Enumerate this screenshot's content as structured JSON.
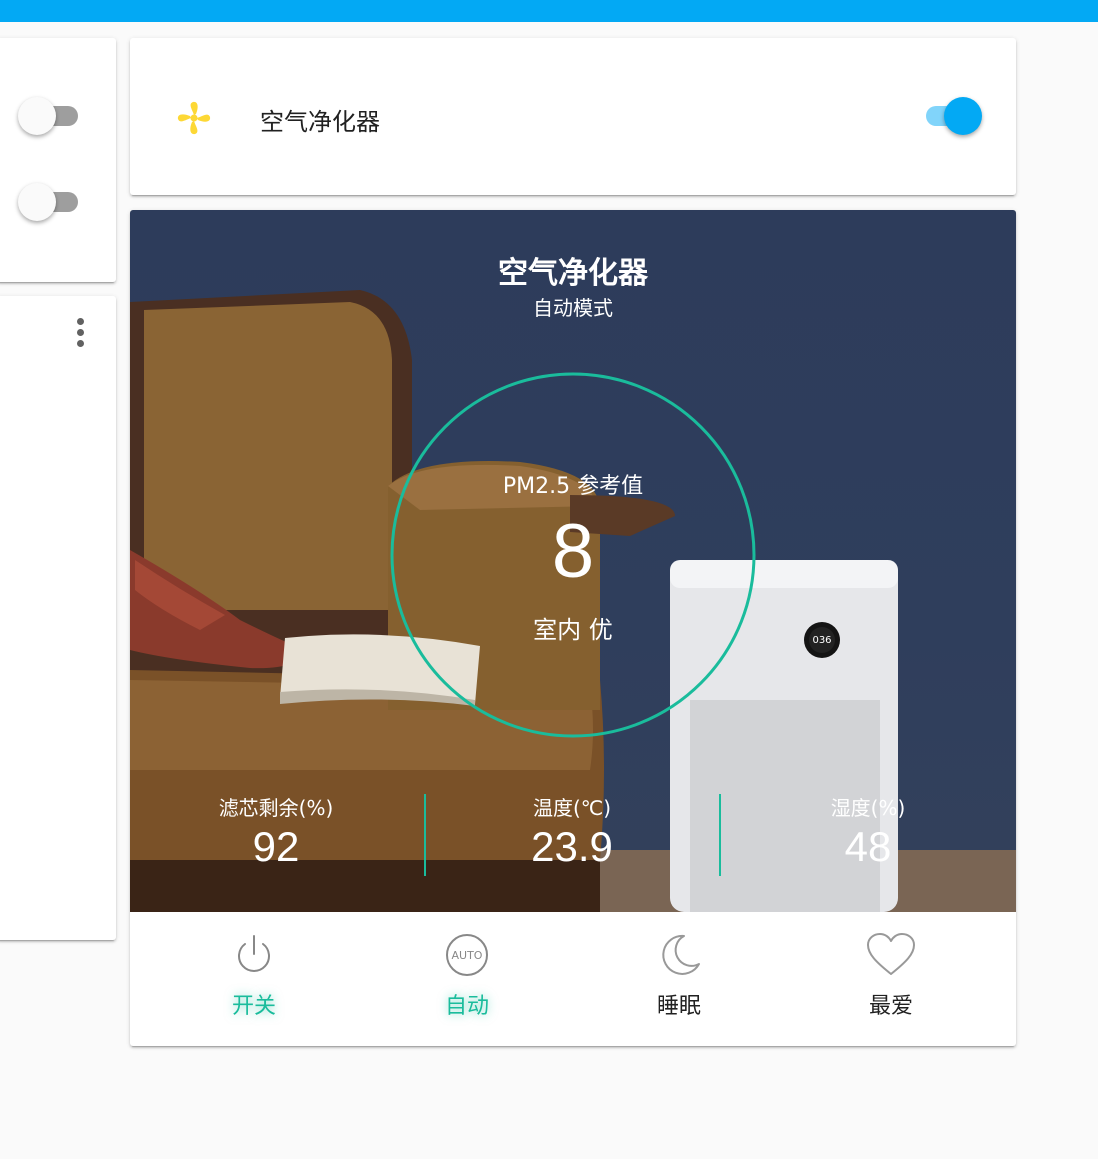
{
  "device": {
    "name": "空气净化器",
    "mode": "自动模式",
    "power_on": true
  },
  "pm25": {
    "label": "PM2.5 参考值",
    "value": "8",
    "quality": "室内 优"
  },
  "stats": [
    {
      "label": "滤芯剩余(%)",
      "value": "92"
    },
    {
      "label": "温度(℃)",
      "value": "23.9"
    },
    {
      "label": "湿度(%)",
      "value": "48"
    }
  ],
  "controls": [
    {
      "label": "开关",
      "icon": "power-icon",
      "active": true
    },
    {
      "label": "自动",
      "icon": "auto-icon",
      "active": true
    },
    {
      "label": "睡眠",
      "icon": "moon-icon",
      "active": false
    },
    {
      "label": "最爱",
      "icon": "heart-icon",
      "active": false
    }
  ],
  "side_toggles": [
    false,
    false
  ],
  "colors": {
    "accent": "#03a9f4",
    "teal": "#1abc9c",
    "fan": "#fdd835"
  }
}
